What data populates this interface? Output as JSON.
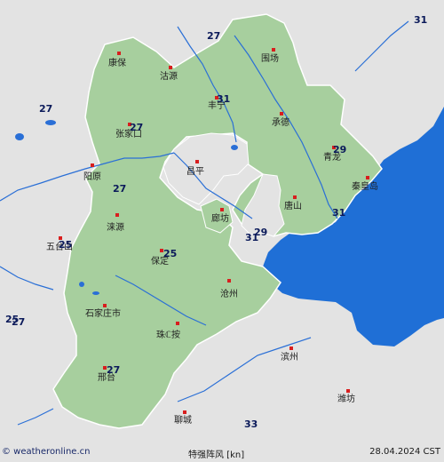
{
  "colors": {
    "land_region": "#a7cf9e",
    "land_outside": "#e3e3e3",
    "sea": "#1f6fd6",
    "river": "#2a6fd6",
    "border": "#ffffff",
    "city_dot": "#d81e1e",
    "gust_text": "#0b1a5a"
  },
  "cities": [
    {
      "name": "康保"
    },
    {
      "name": "沽源"
    },
    {
      "name": "围场"
    },
    {
      "name": "丰宁"
    },
    {
      "name": "承德"
    },
    {
      "name": "张家口"
    },
    {
      "name": "青龙"
    },
    {
      "name": "昌平"
    },
    {
      "name": "阳原"
    },
    {
      "name": "秦皇岛"
    },
    {
      "name": "唐山"
    },
    {
      "name": "涞源"
    },
    {
      "name": "廊坊"
    },
    {
      "name": "五台山"
    },
    {
      "name": "保定"
    },
    {
      "name": "沧州"
    },
    {
      "name": "石家庄市"
    },
    {
      "name": "珠ℂ按"
    },
    {
      "name": "滨州"
    },
    {
      "name": "邢台"
    },
    {
      "name": "潍坊"
    },
    {
      "name": "聊城"
    }
  ],
  "gust_values": [
    {
      "value": "27"
    },
    {
      "value": "31"
    },
    {
      "value": "27"
    },
    {
      "value": "31"
    },
    {
      "value": "27"
    },
    {
      "value": "29"
    },
    {
      "value": "27"
    },
    {
      "value": "31"
    },
    {
      "value": "29"
    },
    {
      "value": "31"
    },
    {
      "value": "25"
    },
    {
      "value": "25"
    },
    {
      "value": "25"
    },
    {
      "value": "27"
    },
    {
      "value": "27"
    },
    {
      "value": "33"
    }
  ],
  "footer": {
    "site": "© weatheronline.cn",
    "title": "特强阵风  [kn]",
    "date": "28.04.2024 CST"
  }
}
